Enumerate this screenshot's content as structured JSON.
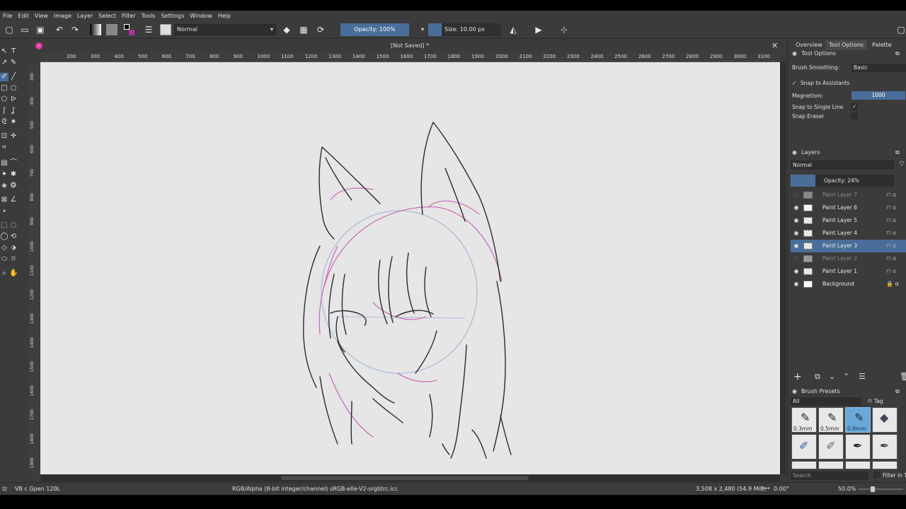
{
  "app": {
    "menu": [
      "File",
      "Edit",
      "View",
      "Image",
      "Layer",
      "Select",
      "Filter",
      "Tools",
      "Settings",
      "Window",
      "Help"
    ]
  },
  "toolbar": {
    "blend_mode": "Normal",
    "opacity": "Opacity: 100%",
    "size": "Size: 10.00 px"
  },
  "document": {
    "tab_title": "[Not Saved]",
    "modified_marker": "*",
    "ruler_top": [
      "200",
      "300",
      "400",
      "500",
      "600",
      "700",
      "800",
      "900",
      "1000",
      "1100",
      "1200",
      "1300",
      "1400",
      "1500",
      "1600",
      "1700",
      "1800",
      "1900",
      "2000",
      "2100",
      "2200",
      "2300",
      "2400",
      "2500",
      "2600",
      "2700",
      "2800",
      "2900",
      "3000",
      "3100",
      "3200"
    ],
    "ruler_left": [
      "300",
      "400",
      "500",
      "600",
      "700",
      "800",
      "900",
      "1000",
      "1100",
      "1200",
      "1300",
      "1400",
      "1500",
      "1600",
      "1700",
      "1800",
      "1900"
    ]
  },
  "dock": {
    "tabs": [
      "Overview",
      "Tool Options",
      "Palette"
    ],
    "tool_options": {
      "title": "Tool Options",
      "brush_smoothing_label": "Brush Smoothing:",
      "brush_smoothing_value": "Basic",
      "snap_to_assistants": "Snap to Assistants",
      "snap_to_assistants_checked": true,
      "magnetism_label": "Magnetism:",
      "magnetism_value": "1000",
      "snap_single_line": "Snap to Single Line",
      "snap_single_line_checked": true,
      "snap_eraser": "Snap Eraser",
      "snap_eraser_checked": false
    },
    "layers": {
      "title": "Layers",
      "blend_mode": "Normal",
      "opacity": "Opacity:  24%",
      "items": [
        {
          "name": "Paint Layer 7",
          "visible": false,
          "selected": false
        },
        {
          "name": "Paint Layer 6",
          "visible": true,
          "selected": false
        },
        {
          "name": "Paint Layer 5",
          "visible": true,
          "selected": false
        },
        {
          "name": "Paint Layer 4",
          "visible": true,
          "selected": false
        },
        {
          "name": "Paint Layer 3",
          "visible": true,
          "selected": true
        },
        {
          "name": "Paint Layer 2",
          "visible": false,
          "selected": false
        },
        {
          "name": "Paint Layer 1",
          "visible": true,
          "selected": false
        },
        {
          "name": "Background",
          "visible": true,
          "selected": false
        }
      ]
    },
    "brush_presets": {
      "title": "Brush Presets",
      "filter": "All",
      "tag_label": "Tag",
      "preset_labels": [
        "0.3mm",
        "0.5mm",
        "0.8mm"
      ],
      "search_placeholder": "Search",
      "filter_in_tag": "Filter in Tag"
    }
  },
  "status": {
    "brush_name": "VB c Gpen 120L",
    "color_info": "RGB/Alpha (8-bit integer/channel)  sRGB-elle-V2-srgbtrc.icc",
    "image_size": "3,508 x 2,480 (54.9 MiB)",
    "rotation": "0.00°",
    "zoom": "50.0%"
  },
  "colors": {
    "accent": "#4a6e9a",
    "panel": "#3b3b3b",
    "canvas": "#e6e6e6"
  }
}
